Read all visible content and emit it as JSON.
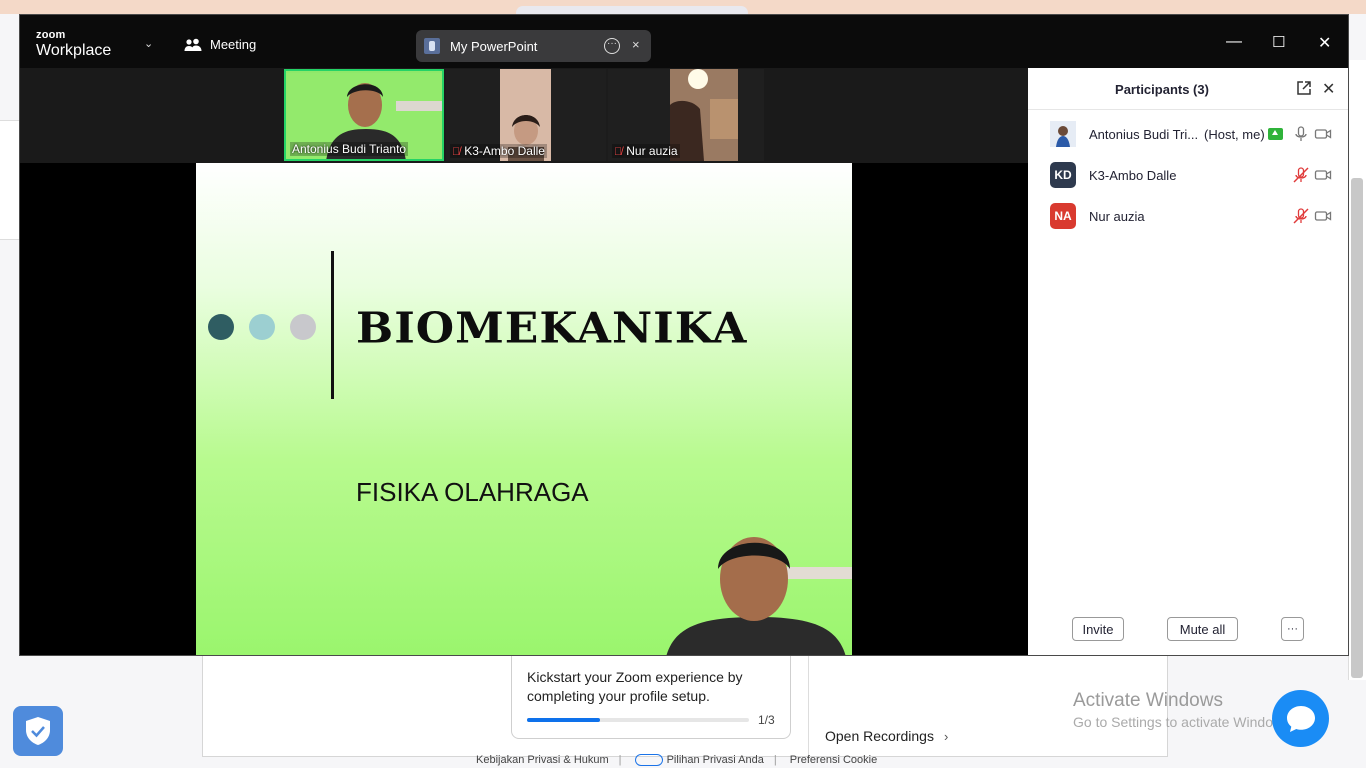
{
  "zoom": {
    "brand_line1": "zoom",
    "brand_line2": "Workplace",
    "meeting_label": "Meeting",
    "share_title": "My PowerPoint",
    "share_more": "···",
    "share_close": "×",
    "win_minimize": "—",
    "win_maximize": "☐",
    "win_close": "✕"
  },
  "gallery": [
    {
      "name": "Antonius Budi Trianto",
      "muted": false,
      "active_speaker": true
    },
    {
      "name": "K3-Ambo Dalle",
      "muted": true,
      "active_speaker": false
    },
    {
      "name": "Nur auzia",
      "muted": true,
      "active_speaker": false
    }
  ],
  "slide": {
    "title": "BIOMEKANIKA",
    "subtitle": "FISIKA OLAHRAGA",
    "dot_colors": [
      "#2f5d62",
      "#9ccfd1",
      "#c8c8cc"
    ]
  },
  "participants": {
    "title": "Participants (3)",
    "popout_icon": "popout-icon",
    "close_label": "✕",
    "list": [
      {
        "name": "Antonius Budi Tri...",
        "tag": "(Host, me)",
        "initials": "",
        "avatar_color": "#dfe6f0",
        "mic": "on",
        "sharing": true
      },
      {
        "name": "K3-Ambo Dalle",
        "tag": "",
        "initials": "KD",
        "avatar_color": "#2e3a4e",
        "mic": "muted",
        "sharing": false
      },
      {
        "name": "Nur auzia",
        "tag": "",
        "initials": "NA",
        "avatar_color": "#d93a2f",
        "mic": "muted",
        "sharing": false
      }
    ],
    "invite_label": "Invite",
    "mute_all_label": "Mute all",
    "more_label": "···"
  },
  "background": {
    "kickstart_text": "Kickstart your Zoom experience by completing your profile setup.",
    "progress_fraction": 0.33,
    "progress_text": "1/3",
    "open_recordings": "Open Recordings",
    "open_recordings_chevron": "›",
    "activate_title": "Activate Windows",
    "activate_sub": "Go to Settings to activate Windows.",
    "footer": [
      "Kebijakan Privasi & Hukum",
      "Pilihan Privasi Anda",
      "Preferensi Cookie"
    ]
  },
  "colors": {
    "accent_blue": "#0e71eb",
    "active_speaker": "#25d366",
    "muted_red": "#e03b3b"
  }
}
